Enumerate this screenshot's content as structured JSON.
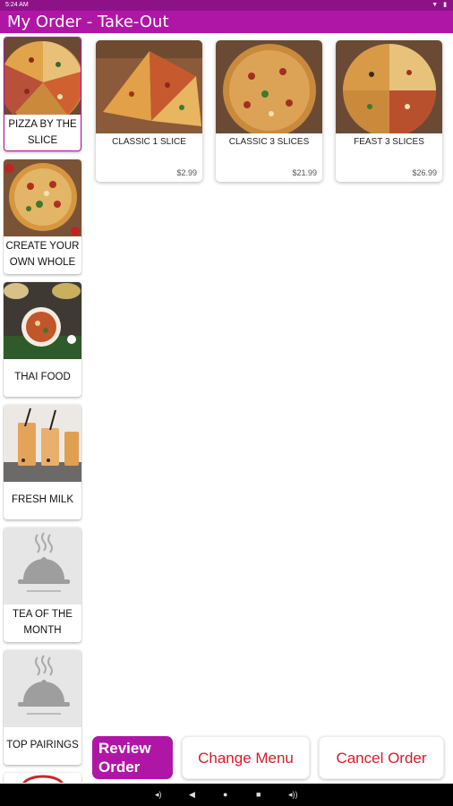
{
  "status_bar": {
    "time": "5:24 AM",
    "icons": "▼ ▮"
  },
  "app_bar": {
    "title": "My Order - Take-Out"
  },
  "categories": [
    {
      "label": "PIZZA BY THE SLICE",
      "selected": true
    },
    {
      "label": "CREATE YOUR OWN WHOLE",
      "selected": false
    },
    {
      "label": "THAI FOOD",
      "selected": false
    },
    {
      "label": "FRESH MILK",
      "selected": false
    },
    {
      "label": "TEA OF THE MONTH",
      "selected": false
    },
    {
      "label": "TOP PAIRINGS",
      "selected": false
    }
  ],
  "items": [
    {
      "name": "CLASSIC 1 SLICE",
      "price": "$2.99"
    },
    {
      "name": "CLASSIC 3 SLICES",
      "price": "$21.99"
    },
    {
      "name": "FEAST 3 SLICES",
      "price": "$26.99"
    }
  ],
  "actions": {
    "review": "Review Order",
    "change_menu": "Change Menu",
    "cancel_order": "Cancel Order"
  },
  "nav_bar": {
    "volume_down": "◂)",
    "back": "◀",
    "home": "●",
    "recents": "■",
    "volume_up": "◂))"
  },
  "colors": {
    "primary": "#b016a6",
    "status_bar": "#8e1287",
    "danger_text": "#d81b2a"
  }
}
